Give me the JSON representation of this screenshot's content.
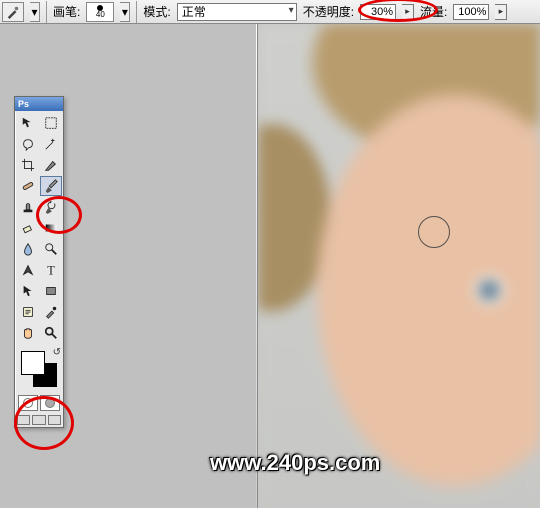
{
  "options_bar": {
    "brush_label": "画笔:",
    "brush_size": "40",
    "mode_label": "模式:",
    "mode_value": "正常",
    "opacity_label": "不透明度:",
    "opacity_value": "30%",
    "flow_label": "流量:",
    "flow_value": "100%"
  },
  "tools_panel": {
    "title": "Ps",
    "tools": [
      {
        "name": "move-tool",
        "icon": "move"
      },
      {
        "name": "marquee-tool",
        "icon": "marquee"
      },
      {
        "name": "lasso-tool",
        "icon": "lasso"
      },
      {
        "name": "quick-select-tool",
        "icon": "wand-area"
      },
      {
        "name": "crop-tool",
        "icon": "crop"
      },
      {
        "name": "slice-tool",
        "icon": "slice"
      },
      {
        "name": "healing-brush-tool",
        "icon": "bandaid"
      },
      {
        "name": "brush-tool",
        "icon": "brush",
        "selected": true
      },
      {
        "name": "clone-stamp-tool",
        "icon": "stamp"
      },
      {
        "name": "history-brush-tool",
        "icon": "historybrush"
      },
      {
        "name": "eraser-tool",
        "icon": "eraser"
      },
      {
        "name": "gradient-tool",
        "icon": "gradient"
      },
      {
        "name": "blur-tool",
        "icon": "droplet"
      },
      {
        "name": "dodge-tool",
        "icon": "dodge"
      },
      {
        "name": "pen-tool",
        "icon": "pen"
      },
      {
        "name": "type-tool",
        "icon": "T"
      },
      {
        "name": "path-select-tool",
        "icon": "arrow"
      },
      {
        "name": "shape-tool",
        "icon": "rect"
      },
      {
        "name": "notes-tool",
        "icon": "note"
      },
      {
        "name": "eyedropper-tool",
        "icon": "eyedropper"
      },
      {
        "name": "hand-tool",
        "icon": "hand"
      },
      {
        "name": "zoom-tool",
        "icon": "zoom"
      }
    ],
    "foreground_color": "#ffffff",
    "background_color": "#000000"
  },
  "canvas": {
    "watermark": "www.240ps.com"
  },
  "annotations": [
    {
      "target": "opacity-input"
    },
    {
      "target": "brush-tool"
    },
    {
      "target": "color-swatches"
    }
  ]
}
